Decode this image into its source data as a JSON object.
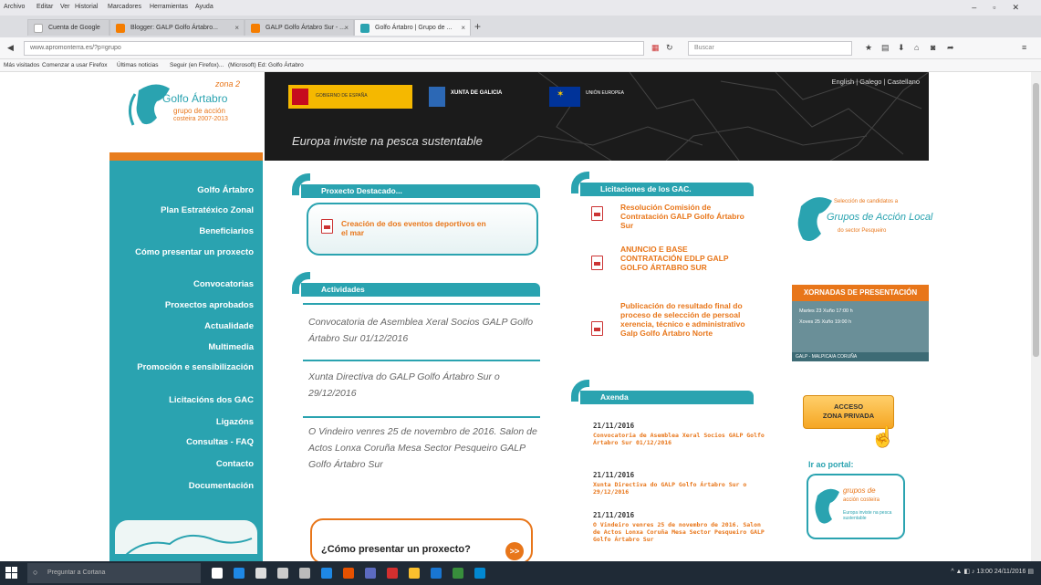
{
  "browser": {
    "menu": [
      "Archivo",
      "Editar",
      "Ver",
      "Historial",
      "Marcadores",
      "Herramientas",
      "Ayuda"
    ],
    "tabs": [
      {
        "label": "Cuenta de Google",
        "color": "#ffffff"
      },
      {
        "label": "Blogger: GALP Golfo Ártabro...",
        "color": "#f57d00"
      },
      {
        "label": "GALP Golfo Ártabro Sur - ...",
        "color": "#f57d00"
      },
      {
        "label": "Golfo Ártabro | Grupo de ...",
        "color": "#2aa3b0"
      }
    ],
    "url": "www.apromonterra.es/?p=grupo",
    "search_placeholder": "Buscar",
    "bookmarks": [
      "Más visitados",
      "Comenzar a usar Firefox",
      "Últimas noticias",
      "Seguir (en Firefox)...",
      "(Microsoft) Ed: Golfo Ártabro"
    ]
  },
  "header": {
    "logo_line1": "zona 2",
    "logo_line2": "Golfo Ártabro",
    "logo_line3": "grupo de acción",
    "logo_line4": "costeira 2007-2013",
    "lang": "English | Galego | Castellano",
    "tagline": "Europa inviste na pesca sustentable",
    "sponsor1": "GOBIERNO DE ESPAÑA",
    "sponsor2": "XUNTA DE GALICIA",
    "sponsor3": "UNIÓN EUROPEA"
  },
  "sidebar": {
    "items": [
      "Golfo Ártabro",
      "Plan Estratéxico Zonal",
      "Beneficiarios",
      "Cómo presentar un proxecto",
      "Convocatorias",
      "Proxectos aprobados",
      "Actualidade",
      "Multimedia",
      "Promoción e sensibilización",
      "Licitacións dos GAC",
      "Ligazóns",
      "Consultas - FAQ",
      "Contacto",
      "Documentación"
    ]
  },
  "destacado": {
    "title": "Proxecto Destacado...",
    "link": "Creación de dos eventos deportivos en el mar"
  },
  "actividades": {
    "title": "Actividades",
    "items": [
      "Convocatoria de Asemblea Xeral Socios GALP Golfo Ártabro Sur 01/12/2016",
      "Xunta Directiva do GALP Golfo Ártabro Sur o 29/12/2016",
      "O Vindeiro venres 25 de novembro de 2016. Salon de Actos Lonxa Coruña Mesa Sector Pesqueiro GALP Golfo Ártabro Sur"
    ]
  },
  "como": {
    "label": "¿Cómo presentar un proxecto?",
    "arrow": ">>"
  },
  "licitaciones": {
    "title": "Licitaciones de los GAC.",
    "items": [
      "Resolución Comisión de Contratación GALP Golfo Ártabro Sur",
      "ANUNCIO E BASE CONTRATACIÓN EDLP GALP GOLFO ÁRTABRO SUR",
      "Publicación do resultado final do proceso de selección de persoal xerencia, técnico e administrativo Galp Golfo Ártabro Norte"
    ]
  },
  "axenda": {
    "title": "Axenda",
    "items": [
      {
        "date": "21/11/2016",
        "text": "Convocatoria de Asemblea Xeral Socios GALP Golfo Ártabro Sur 01/12/2016"
      },
      {
        "date": "21/11/2016",
        "text": "Xunta Directiva do GALP Golfo Ártabro Sur o 29/12/2016"
      },
      {
        "date": "21/11/2016",
        "text": "O Vindeiro venres 25 de novembro de 2016. Salon de Actos Lonxa Coruña Mesa Sector Pesqueiro GALP Golfo Ártabro Sur"
      }
    ]
  },
  "right": {
    "gal_line1": "Selección de candidatos a",
    "gal_line2": "Grupos de Acción Local",
    "gal_line3": "do sector Pesqueiro",
    "xornadas_title": "XORNADAS DE PRESENTACIÓN",
    "xornadas_l1": "Martes 23 Xuño 17:00 h",
    "xornadas_l2": "Xoves 25 Xuño 19:00 h",
    "xornadas_foot": "GALP - MALPICA/A CORUÑA",
    "acceso_l1": "ACCESO",
    "acceso_l2": "ZONA PRIVADA",
    "portal_label": "Ir ao portal:",
    "portal_l1": "grupos de",
    "portal_l2": "acción costeira",
    "portal_l3": "Europa inviste na pesca sustentable"
  },
  "taskbar": {
    "search_placeholder": "Preguntar a Cortana",
    "clock": "13:00",
    "date": "24/11/2016"
  },
  "colors": {
    "teal": "#2aa3b0",
    "orange": "#e8761a",
    "banner": "#1b1b1b"
  }
}
